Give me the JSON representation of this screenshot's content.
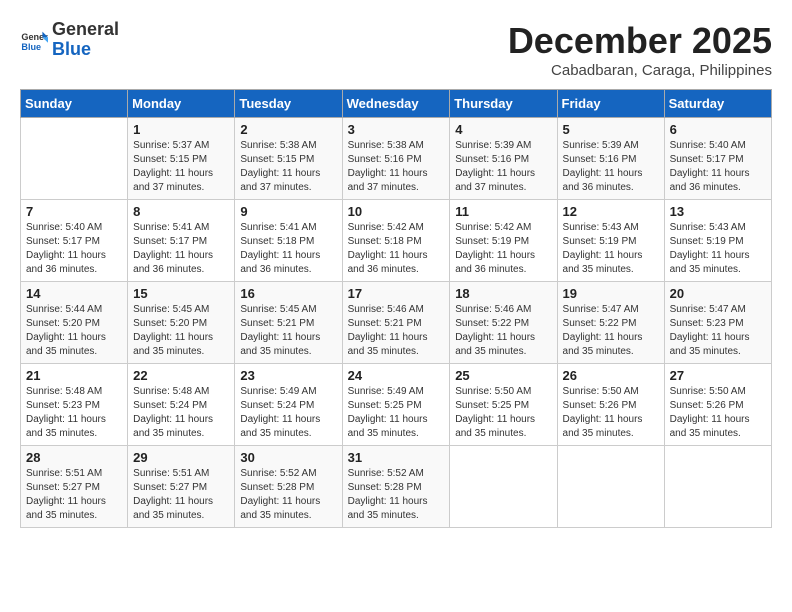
{
  "logo": {
    "general": "General",
    "blue": "Blue"
  },
  "title": {
    "month_year": "December 2025",
    "location": "Cabadbaran, Caraga, Philippines"
  },
  "weekdays": [
    "Sunday",
    "Monday",
    "Tuesday",
    "Wednesday",
    "Thursday",
    "Friday",
    "Saturday"
  ],
  "weeks": [
    [
      {
        "day": "",
        "info": ""
      },
      {
        "day": "1",
        "info": "Sunrise: 5:37 AM\nSunset: 5:15 PM\nDaylight: 11 hours\nand 37 minutes."
      },
      {
        "day": "2",
        "info": "Sunrise: 5:38 AM\nSunset: 5:15 PM\nDaylight: 11 hours\nand 37 minutes."
      },
      {
        "day": "3",
        "info": "Sunrise: 5:38 AM\nSunset: 5:16 PM\nDaylight: 11 hours\nand 37 minutes."
      },
      {
        "day": "4",
        "info": "Sunrise: 5:39 AM\nSunset: 5:16 PM\nDaylight: 11 hours\nand 37 minutes."
      },
      {
        "day": "5",
        "info": "Sunrise: 5:39 AM\nSunset: 5:16 PM\nDaylight: 11 hours\nand 36 minutes."
      },
      {
        "day": "6",
        "info": "Sunrise: 5:40 AM\nSunset: 5:17 PM\nDaylight: 11 hours\nand 36 minutes."
      }
    ],
    [
      {
        "day": "7",
        "info": "Sunrise: 5:40 AM\nSunset: 5:17 PM\nDaylight: 11 hours\nand 36 minutes."
      },
      {
        "day": "8",
        "info": "Sunrise: 5:41 AM\nSunset: 5:17 PM\nDaylight: 11 hours\nand 36 minutes."
      },
      {
        "day": "9",
        "info": "Sunrise: 5:41 AM\nSunset: 5:18 PM\nDaylight: 11 hours\nand 36 minutes."
      },
      {
        "day": "10",
        "info": "Sunrise: 5:42 AM\nSunset: 5:18 PM\nDaylight: 11 hours\nand 36 minutes."
      },
      {
        "day": "11",
        "info": "Sunrise: 5:42 AM\nSunset: 5:19 PM\nDaylight: 11 hours\nand 36 minutes."
      },
      {
        "day": "12",
        "info": "Sunrise: 5:43 AM\nSunset: 5:19 PM\nDaylight: 11 hours\nand 35 minutes."
      },
      {
        "day": "13",
        "info": "Sunrise: 5:43 AM\nSunset: 5:19 PM\nDaylight: 11 hours\nand 35 minutes."
      }
    ],
    [
      {
        "day": "14",
        "info": "Sunrise: 5:44 AM\nSunset: 5:20 PM\nDaylight: 11 hours\nand 35 minutes."
      },
      {
        "day": "15",
        "info": "Sunrise: 5:45 AM\nSunset: 5:20 PM\nDaylight: 11 hours\nand 35 minutes."
      },
      {
        "day": "16",
        "info": "Sunrise: 5:45 AM\nSunset: 5:21 PM\nDaylight: 11 hours\nand 35 minutes."
      },
      {
        "day": "17",
        "info": "Sunrise: 5:46 AM\nSunset: 5:21 PM\nDaylight: 11 hours\nand 35 minutes."
      },
      {
        "day": "18",
        "info": "Sunrise: 5:46 AM\nSunset: 5:22 PM\nDaylight: 11 hours\nand 35 minutes."
      },
      {
        "day": "19",
        "info": "Sunrise: 5:47 AM\nSunset: 5:22 PM\nDaylight: 11 hours\nand 35 minutes."
      },
      {
        "day": "20",
        "info": "Sunrise: 5:47 AM\nSunset: 5:23 PM\nDaylight: 11 hours\nand 35 minutes."
      }
    ],
    [
      {
        "day": "21",
        "info": "Sunrise: 5:48 AM\nSunset: 5:23 PM\nDaylight: 11 hours\nand 35 minutes."
      },
      {
        "day": "22",
        "info": "Sunrise: 5:48 AM\nSunset: 5:24 PM\nDaylight: 11 hours\nand 35 minutes."
      },
      {
        "day": "23",
        "info": "Sunrise: 5:49 AM\nSunset: 5:24 PM\nDaylight: 11 hours\nand 35 minutes."
      },
      {
        "day": "24",
        "info": "Sunrise: 5:49 AM\nSunset: 5:25 PM\nDaylight: 11 hours\nand 35 minutes."
      },
      {
        "day": "25",
        "info": "Sunrise: 5:50 AM\nSunset: 5:25 PM\nDaylight: 11 hours\nand 35 minutes."
      },
      {
        "day": "26",
        "info": "Sunrise: 5:50 AM\nSunset: 5:26 PM\nDaylight: 11 hours\nand 35 minutes."
      },
      {
        "day": "27",
        "info": "Sunrise: 5:50 AM\nSunset: 5:26 PM\nDaylight: 11 hours\nand 35 minutes."
      }
    ],
    [
      {
        "day": "28",
        "info": "Sunrise: 5:51 AM\nSunset: 5:27 PM\nDaylight: 11 hours\nand 35 minutes."
      },
      {
        "day": "29",
        "info": "Sunrise: 5:51 AM\nSunset: 5:27 PM\nDaylight: 11 hours\nand 35 minutes."
      },
      {
        "day": "30",
        "info": "Sunrise: 5:52 AM\nSunset: 5:28 PM\nDaylight: 11 hours\nand 35 minutes."
      },
      {
        "day": "31",
        "info": "Sunrise: 5:52 AM\nSunset: 5:28 PM\nDaylight: 11 hours\nand 35 minutes."
      },
      {
        "day": "",
        "info": ""
      },
      {
        "day": "",
        "info": ""
      },
      {
        "day": "",
        "info": ""
      }
    ]
  ]
}
